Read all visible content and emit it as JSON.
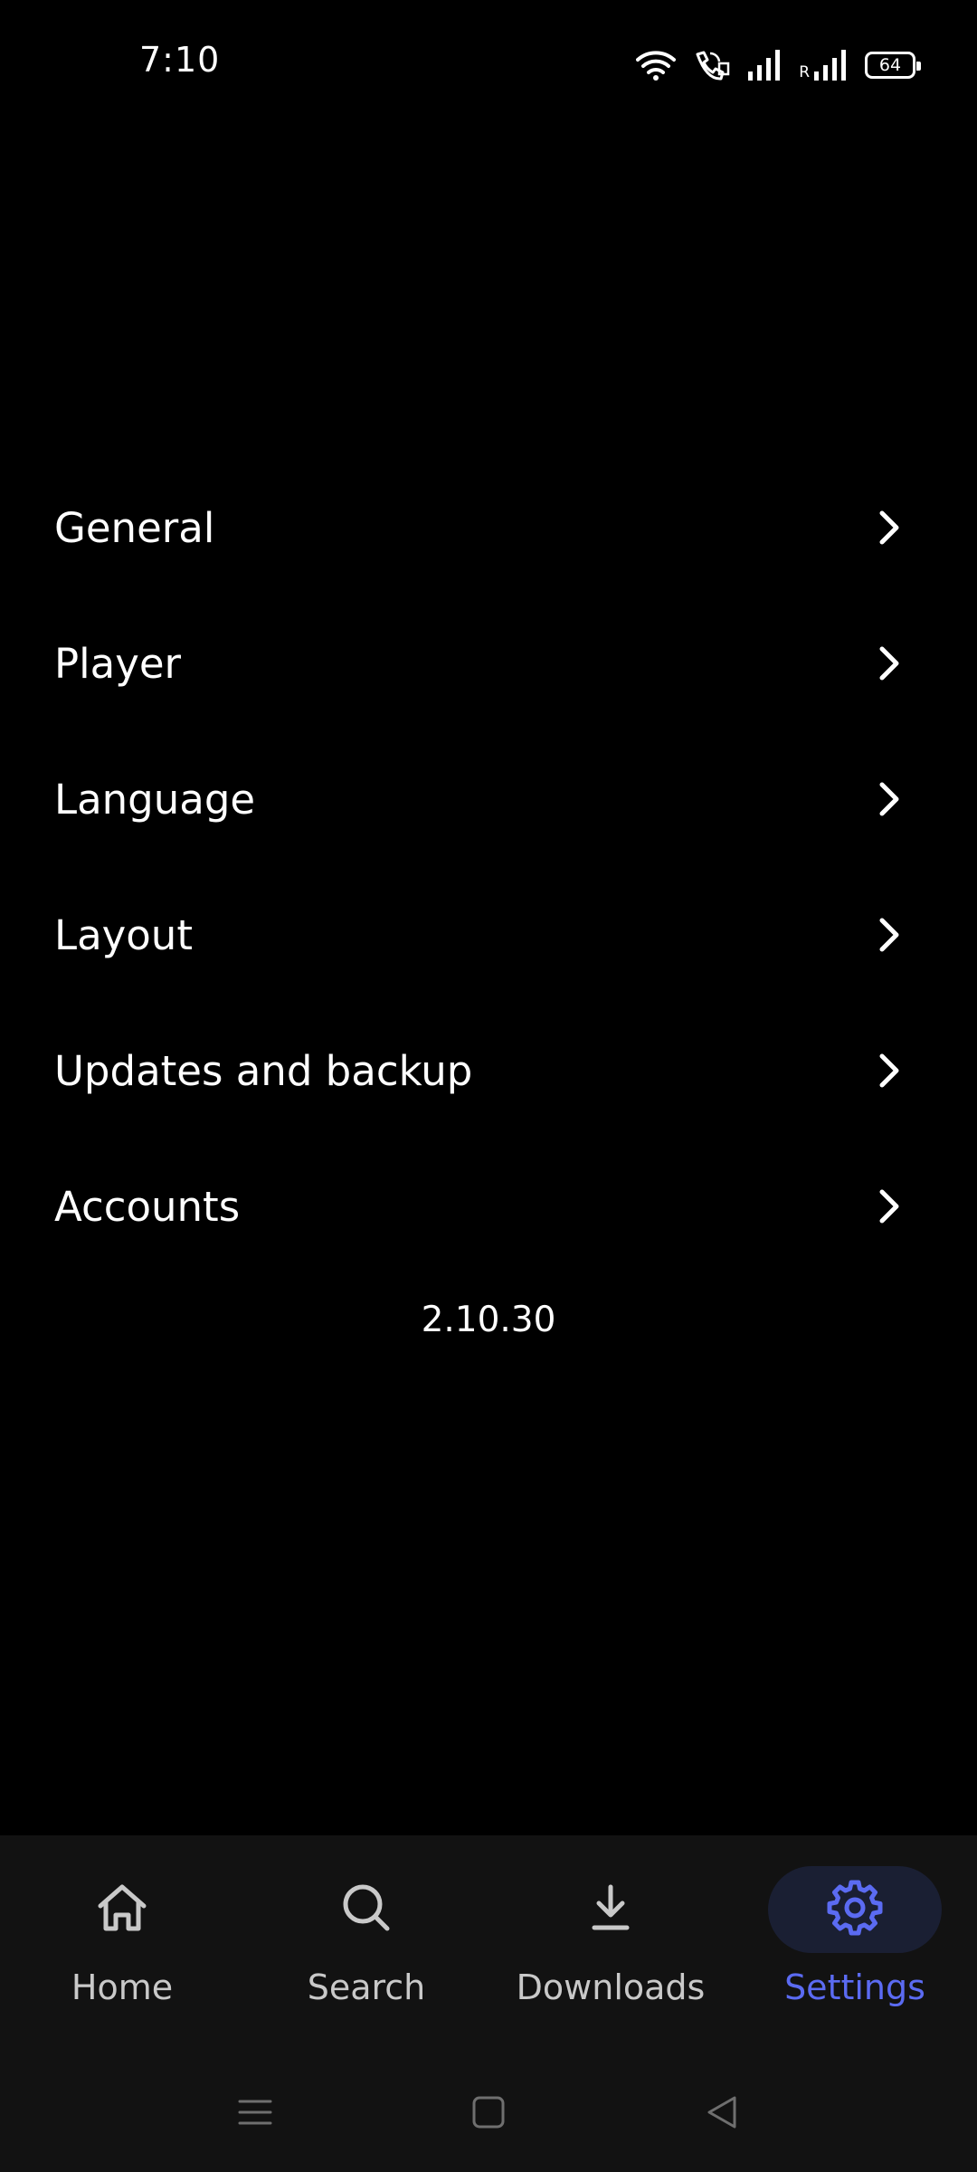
{
  "status_bar": {
    "time": "7:10",
    "battery": "64",
    "roaming_label": "R",
    "icons": [
      "wifi-icon",
      "wifi-calling-icon",
      "signal-icon",
      "roaming-signal-icon",
      "battery-icon"
    ]
  },
  "settings": {
    "items": [
      {
        "label": "General",
        "icon": "chevron-right-icon"
      },
      {
        "label": "Player",
        "icon": "chevron-right-icon"
      },
      {
        "label": "Language",
        "icon": "chevron-right-icon"
      },
      {
        "label": "Layout",
        "icon": "chevron-right-icon"
      },
      {
        "label": "Updates and backup",
        "icon": "chevron-right-icon"
      },
      {
        "label": "Accounts",
        "icon": "chevron-right-icon"
      }
    ],
    "version": "2.10.30"
  },
  "bottom_nav": {
    "items": [
      {
        "label": "Home",
        "icon": "home-icon",
        "active": false
      },
      {
        "label": "Search",
        "icon": "search-icon",
        "active": false
      },
      {
        "label": "Downloads",
        "icon": "download-icon",
        "active": false
      },
      {
        "label": "Settings",
        "icon": "gear-icon",
        "active": true
      }
    ]
  },
  "system_nav": {
    "icons": [
      "menu-icon",
      "home-square-icon",
      "back-triangle-icon"
    ]
  },
  "colors": {
    "background": "#000000",
    "nav_background": "#121212",
    "accent": "#5b6bf2",
    "active_pill": "#1a1f33",
    "inactive_nav": "#c9c9c9"
  }
}
